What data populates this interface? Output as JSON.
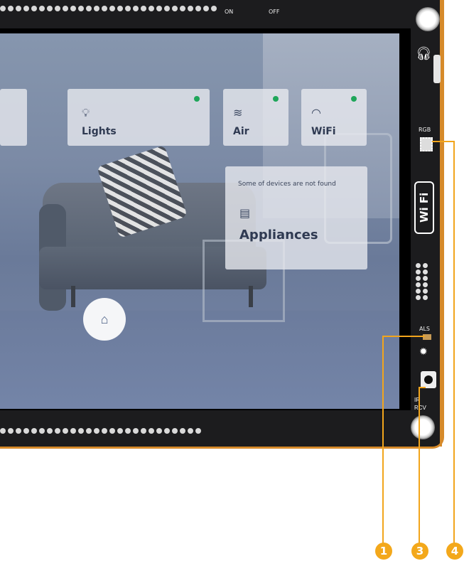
{
  "board": {
    "switch_on": "ON",
    "switch_off": "OFF",
    "label_rgb": "RGB",
    "label_als": "ALS",
    "label_ir": "IR",
    "label_rcv": "RCV",
    "label_wifi": "Wi Fi",
    "accent_color": "#d68a2a"
  },
  "ui": {
    "lights_label": "Lights",
    "air_label": "Air",
    "wifi_label": "WiFi",
    "appliances_note": "Some of devices are not found",
    "appliances_label": "Appliances",
    "status_color": "#1fa65a"
  },
  "icons": {
    "lights": "bulb-icon",
    "air": "wind-icon",
    "wifi": "wifi-icon",
    "appliances": "appliance-icon",
    "home": "home-icon"
  },
  "callouts": {
    "one": "1",
    "three": "3",
    "four": "4",
    "color": "#f3a81b"
  }
}
